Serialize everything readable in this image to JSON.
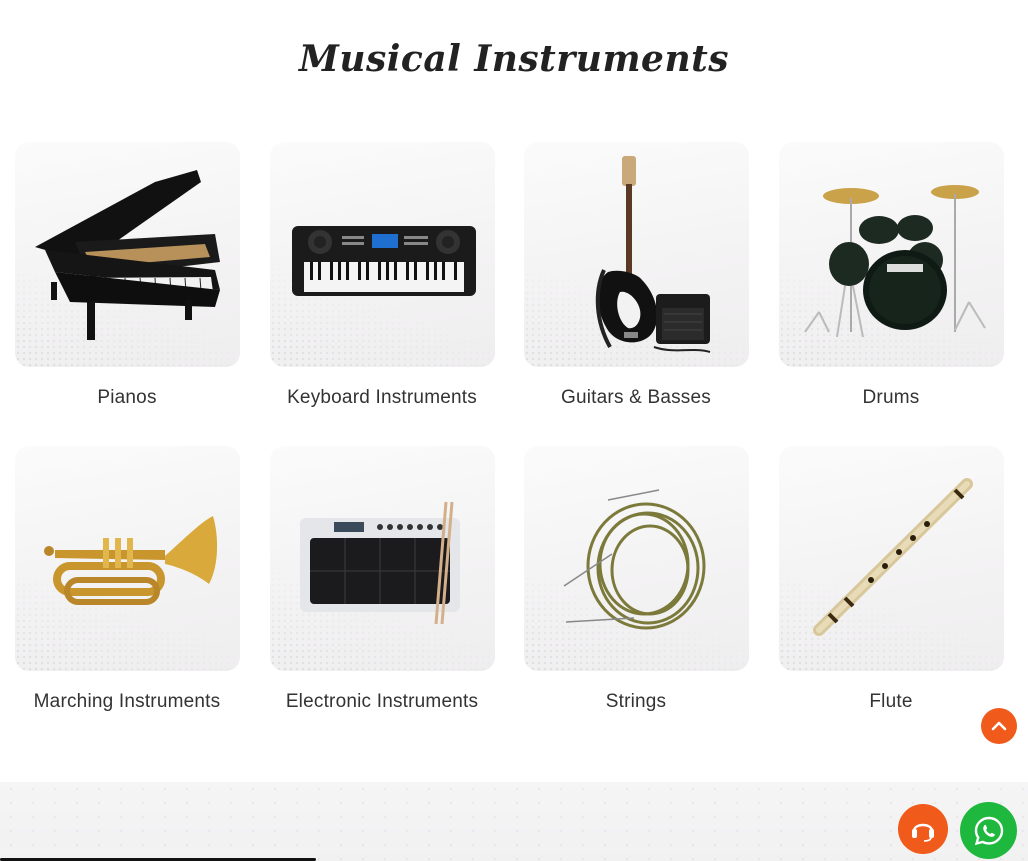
{
  "section": {
    "title": "Musical Instruments"
  },
  "categories": [
    {
      "label": "Pianos",
      "icon": "piano-icon"
    },
    {
      "label": "Keyboard Instruments",
      "icon": "keyboard-icon"
    },
    {
      "label": "Guitars & Basses",
      "icon": "bass-guitar-icon"
    },
    {
      "label": "Drums",
      "icon": "drum-kit-icon"
    },
    {
      "label": "Marching Instruments",
      "icon": "marching-horn-icon"
    },
    {
      "label": "Electronic Instruments",
      "icon": "drum-pad-icon"
    },
    {
      "label": "Strings",
      "icon": "guitar-strings-icon"
    },
    {
      "label": "Flute",
      "icon": "bamboo-flute-icon"
    }
  ],
  "floating": {
    "scroll_top_icon": "chevron-up-icon",
    "support_icon": "headset-icon",
    "whatsapp_icon": "whatsapp-icon"
  },
  "colors": {
    "accent": "#f05a1a",
    "whatsapp": "#1fb83f",
    "card_bg": "#f4f3f4"
  }
}
